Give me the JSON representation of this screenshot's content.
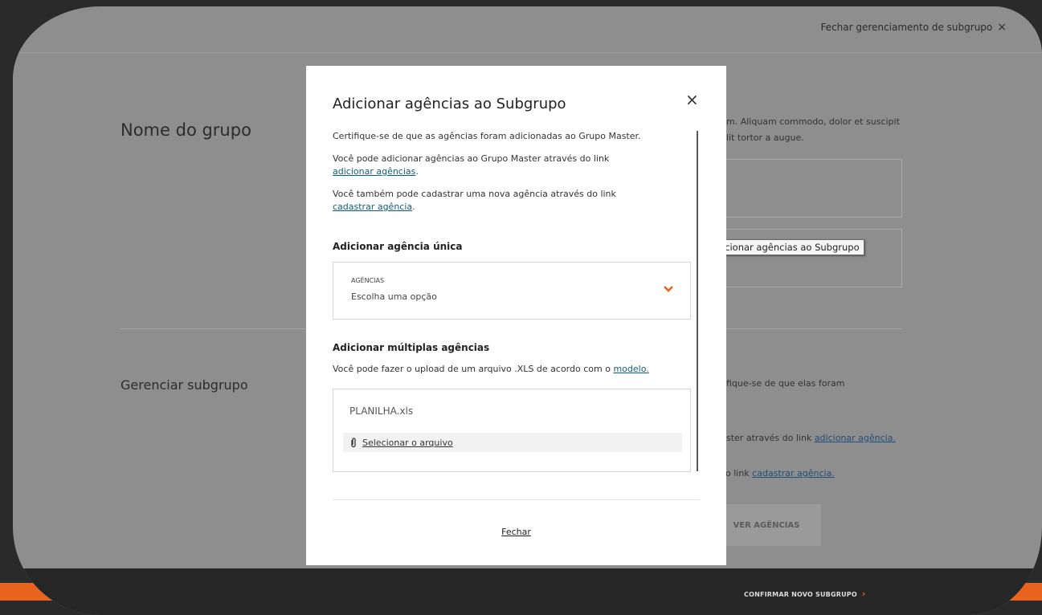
{
  "topbar": {
    "close_label": "Fechar gerenciamento de subgrupo",
    "close_icon": "×"
  },
  "page": {
    "group_heading": "Nome do grupo",
    "subgroup_heading": "Gerenciar subgrupo",
    "bg_text_1": "m. Aliquam commodo, dolor et suscipit",
    "bg_text_2": "lit tortor a augue.",
    "bg_text_3": "fique-se de que elas foram",
    "bg_text_4_prefix": "ster através do link ",
    "bg_text_4_link": "adicionar agência.",
    "bg_text_5_prefix": " do link ",
    "bg_text_5_link": "cadastrar agência.",
    "remove_button": "VER AGÊNCIAS"
  },
  "footer": {
    "confirm_label": "CONFIRMAR NOVO SUBGRUPO",
    "confirm_arrow": "›"
  },
  "tooltip": "Adicionar agências ao Subgrupo",
  "modal": {
    "title": "Adicionar agências ao Subgrupo",
    "close_icon": "×",
    "intro": "Certifique-se de que as agências foram adicionadas ao Grupo Master.",
    "add_text": "Você pode adicionar agências ao Grupo Master através do link",
    "add_link": "adicionar agências",
    "register_text": "Você também pode cadastrar uma nova agência através do link",
    "register_link": "cadastrar agência",
    "single_title": "Adicionar agência única",
    "select_label": "AGÊNCIAS",
    "select_value": "Escolha uma opção",
    "multi_title": "Adicionar múltiplas agências",
    "upload_text": "Você pode fazer o upload de um arquivo .XLS de acordo com o",
    "upload_link": "modelo.",
    "file_name": "PLANILHA.xls",
    "select_file": "Selecionar o arquivo",
    "close_button": "Fechar"
  },
  "colors": {
    "accent": "#e8641e",
    "link": "#0e5f7a",
    "overlay": "#8e8e8e"
  }
}
